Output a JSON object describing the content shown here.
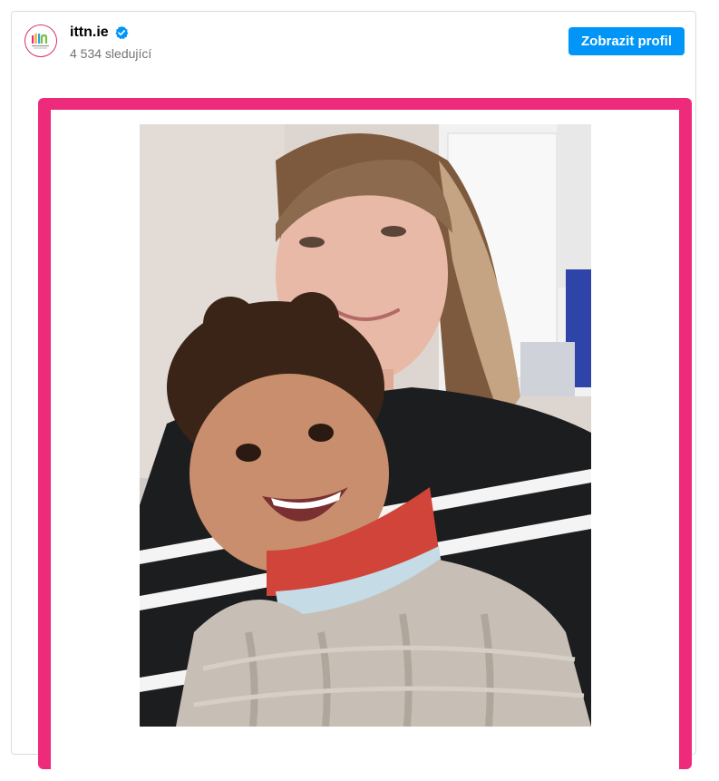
{
  "account": {
    "name": "ittn.ie",
    "verified": true,
    "followers_text": "4 534 sledující",
    "avatar_icon": "ittn-logo-avatar"
  },
  "actions": {
    "view_profile_label": "Zobrazit profil"
  },
  "colors": {
    "primary_button": "#0095f6",
    "frame_accent": "#ee2a7b",
    "verified_badge": "#0095f6"
  },
  "post": {
    "image": "photo-of-woman-and-smiling-toddler"
  }
}
